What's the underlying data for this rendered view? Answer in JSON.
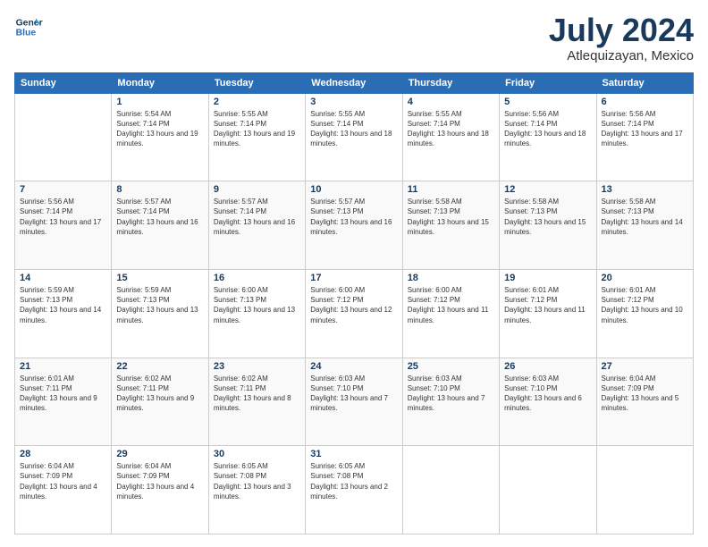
{
  "logo": {
    "line1": "General",
    "line2": "Blue"
  },
  "title": "July 2024",
  "location": "Atlequizayan, Mexico",
  "days_of_week": [
    "Sunday",
    "Monday",
    "Tuesday",
    "Wednesday",
    "Thursday",
    "Friday",
    "Saturday"
  ],
  "weeks": [
    [
      {
        "day": "",
        "sunrise": "",
        "sunset": "",
        "daylight": ""
      },
      {
        "day": "1",
        "sunrise": "Sunrise: 5:54 AM",
        "sunset": "Sunset: 7:14 PM",
        "daylight": "Daylight: 13 hours and 19 minutes."
      },
      {
        "day": "2",
        "sunrise": "Sunrise: 5:55 AM",
        "sunset": "Sunset: 7:14 PM",
        "daylight": "Daylight: 13 hours and 19 minutes."
      },
      {
        "day": "3",
        "sunrise": "Sunrise: 5:55 AM",
        "sunset": "Sunset: 7:14 PM",
        "daylight": "Daylight: 13 hours and 18 minutes."
      },
      {
        "day": "4",
        "sunrise": "Sunrise: 5:55 AM",
        "sunset": "Sunset: 7:14 PM",
        "daylight": "Daylight: 13 hours and 18 minutes."
      },
      {
        "day": "5",
        "sunrise": "Sunrise: 5:56 AM",
        "sunset": "Sunset: 7:14 PM",
        "daylight": "Daylight: 13 hours and 18 minutes."
      },
      {
        "day": "6",
        "sunrise": "Sunrise: 5:56 AM",
        "sunset": "Sunset: 7:14 PM",
        "daylight": "Daylight: 13 hours and 17 minutes."
      }
    ],
    [
      {
        "day": "7",
        "sunrise": "Sunrise: 5:56 AM",
        "sunset": "Sunset: 7:14 PM",
        "daylight": "Daylight: 13 hours and 17 minutes."
      },
      {
        "day": "8",
        "sunrise": "Sunrise: 5:57 AM",
        "sunset": "Sunset: 7:14 PM",
        "daylight": "Daylight: 13 hours and 16 minutes."
      },
      {
        "day": "9",
        "sunrise": "Sunrise: 5:57 AM",
        "sunset": "Sunset: 7:14 PM",
        "daylight": "Daylight: 13 hours and 16 minutes."
      },
      {
        "day": "10",
        "sunrise": "Sunrise: 5:57 AM",
        "sunset": "Sunset: 7:13 PM",
        "daylight": "Daylight: 13 hours and 16 minutes."
      },
      {
        "day": "11",
        "sunrise": "Sunrise: 5:58 AM",
        "sunset": "Sunset: 7:13 PM",
        "daylight": "Daylight: 13 hours and 15 minutes."
      },
      {
        "day": "12",
        "sunrise": "Sunrise: 5:58 AM",
        "sunset": "Sunset: 7:13 PM",
        "daylight": "Daylight: 13 hours and 15 minutes."
      },
      {
        "day": "13",
        "sunrise": "Sunrise: 5:58 AM",
        "sunset": "Sunset: 7:13 PM",
        "daylight": "Daylight: 13 hours and 14 minutes."
      }
    ],
    [
      {
        "day": "14",
        "sunrise": "Sunrise: 5:59 AM",
        "sunset": "Sunset: 7:13 PM",
        "daylight": "Daylight: 13 hours and 14 minutes."
      },
      {
        "day": "15",
        "sunrise": "Sunrise: 5:59 AM",
        "sunset": "Sunset: 7:13 PM",
        "daylight": "Daylight: 13 hours and 13 minutes."
      },
      {
        "day": "16",
        "sunrise": "Sunrise: 6:00 AM",
        "sunset": "Sunset: 7:13 PM",
        "daylight": "Daylight: 13 hours and 13 minutes."
      },
      {
        "day": "17",
        "sunrise": "Sunrise: 6:00 AM",
        "sunset": "Sunset: 7:12 PM",
        "daylight": "Daylight: 13 hours and 12 minutes."
      },
      {
        "day": "18",
        "sunrise": "Sunrise: 6:00 AM",
        "sunset": "Sunset: 7:12 PM",
        "daylight": "Daylight: 13 hours and 11 minutes."
      },
      {
        "day": "19",
        "sunrise": "Sunrise: 6:01 AM",
        "sunset": "Sunset: 7:12 PM",
        "daylight": "Daylight: 13 hours and 11 minutes."
      },
      {
        "day": "20",
        "sunrise": "Sunrise: 6:01 AM",
        "sunset": "Sunset: 7:12 PM",
        "daylight": "Daylight: 13 hours and 10 minutes."
      }
    ],
    [
      {
        "day": "21",
        "sunrise": "Sunrise: 6:01 AM",
        "sunset": "Sunset: 7:11 PM",
        "daylight": "Daylight: 13 hours and 9 minutes."
      },
      {
        "day": "22",
        "sunrise": "Sunrise: 6:02 AM",
        "sunset": "Sunset: 7:11 PM",
        "daylight": "Daylight: 13 hours and 9 minutes."
      },
      {
        "day": "23",
        "sunrise": "Sunrise: 6:02 AM",
        "sunset": "Sunset: 7:11 PM",
        "daylight": "Daylight: 13 hours and 8 minutes."
      },
      {
        "day": "24",
        "sunrise": "Sunrise: 6:03 AM",
        "sunset": "Sunset: 7:10 PM",
        "daylight": "Daylight: 13 hours and 7 minutes."
      },
      {
        "day": "25",
        "sunrise": "Sunrise: 6:03 AM",
        "sunset": "Sunset: 7:10 PM",
        "daylight": "Daylight: 13 hours and 7 minutes."
      },
      {
        "day": "26",
        "sunrise": "Sunrise: 6:03 AM",
        "sunset": "Sunset: 7:10 PM",
        "daylight": "Daylight: 13 hours and 6 minutes."
      },
      {
        "day": "27",
        "sunrise": "Sunrise: 6:04 AM",
        "sunset": "Sunset: 7:09 PM",
        "daylight": "Daylight: 13 hours and 5 minutes."
      }
    ],
    [
      {
        "day": "28",
        "sunrise": "Sunrise: 6:04 AM",
        "sunset": "Sunset: 7:09 PM",
        "daylight": "Daylight: 13 hours and 4 minutes."
      },
      {
        "day": "29",
        "sunrise": "Sunrise: 6:04 AM",
        "sunset": "Sunset: 7:09 PM",
        "daylight": "Daylight: 13 hours and 4 minutes."
      },
      {
        "day": "30",
        "sunrise": "Sunrise: 6:05 AM",
        "sunset": "Sunset: 7:08 PM",
        "daylight": "Daylight: 13 hours and 3 minutes."
      },
      {
        "day": "31",
        "sunrise": "Sunrise: 6:05 AM",
        "sunset": "Sunset: 7:08 PM",
        "daylight": "Daylight: 13 hours and 2 minutes."
      },
      {
        "day": "",
        "sunrise": "",
        "sunset": "",
        "daylight": ""
      },
      {
        "day": "",
        "sunrise": "",
        "sunset": "",
        "daylight": ""
      },
      {
        "day": "",
        "sunrise": "",
        "sunset": "",
        "daylight": ""
      }
    ]
  ]
}
